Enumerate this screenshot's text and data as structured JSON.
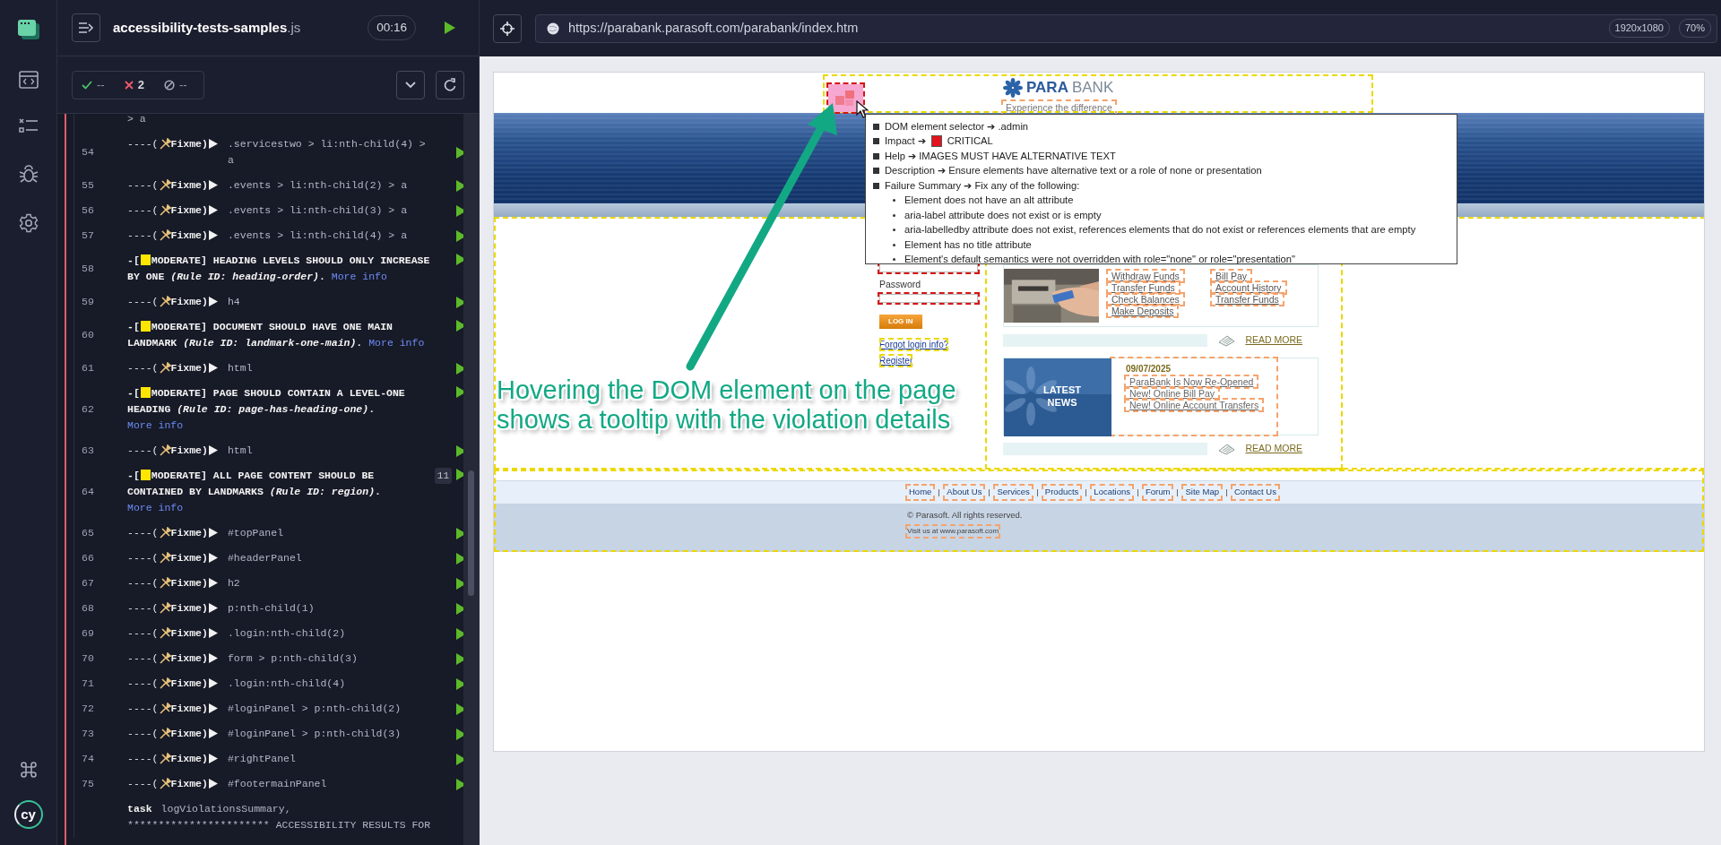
{
  "sidebar": {
    "logo_text": "cy"
  },
  "spec": {
    "name": "accessibility-tests-samples",
    "extension": ".js",
    "duration": "00:16"
  },
  "stats": {
    "passed": "--",
    "failed": "2",
    "pending": "--"
  },
  "log": [
    {
      "kind": "continuation",
      "selector": "> a"
    },
    {
      "kind": "fixme",
      "number": "54",
      "dashes": "----(",
      "tag": "Fixme)",
      "selector": ".servicestwo > li:nth-child(4) > a"
    },
    {
      "kind": "fixme",
      "number": "55",
      "dashes": "----(",
      "tag": "Fixme)",
      "selector": ".events > li:nth-child(2) > a"
    },
    {
      "kind": "fixme",
      "number": "56",
      "dashes": "----(",
      "tag": "Fixme)",
      "selector": ".events > li:nth-child(3) > a"
    },
    {
      "kind": "fixme",
      "number": "57",
      "dashes": "----(",
      "tag": "Fixme)",
      "selector": ".events > li:nth-child(4) > a"
    },
    {
      "kind": "violation",
      "number": "58",
      "dashes": "-[",
      "color": "#ffe600",
      "message": "MODERATE]  HEADING LEVELS SHOULD ONLY INCREASE BY ONE *(Rule ID: heading-order)*.",
      "link": "More info"
    },
    {
      "kind": "fixme",
      "number": "59",
      "dashes": "----(",
      "tag": "Fixme)",
      "selector": "h4"
    },
    {
      "kind": "violation",
      "number": "60",
      "dashes": "-[",
      "color": "#ffe600",
      "message": "MODERATE]  DOCUMENT SHOULD HAVE ONE MAIN LANDMARK *(Rule ID: landmark-one-main)*.",
      "link": "More info"
    },
    {
      "kind": "fixme",
      "number": "61",
      "dashes": "----(",
      "tag": "Fixme)",
      "selector": "html"
    },
    {
      "kind": "violation",
      "number": "62",
      "dashes": "-[",
      "color": "#ffe600",
      "message": "MODERATE]  PAGE SHOULD CONTAIN A LEVEL-ONE HEADING *(Rule ID: page-has-heading-one)*.",
      "link": "More info"
    },
    {
      "kind": "fixme",
      "number": "63",
      "dashes": "----(",
      "tag": "Fixme)",
      "selector": "html"
    },
    {
      "kind": "violation",
      "number": "64",
      "dashes": "-[",
      "color": "#ffe600",
      "message": "MODERATE]  ALL PAGE CONTENT SHOULD BE CONTAINED BY LANDMARKS *(Rule ID: region)*.",
      "link": "More info",
      "badge": "11"
    },
    {
      "kind": "fixme",
      "number": "65",
      "dashes": "----(",
      "tag": "Fixme)",
      "selector": "#topPanel"
    },
    {
      "kind": "fixme",
      "number": "66",
      "dashes": "----(",
      "tag": "Fixme)",
      "selector": "#headerPanel"
    },
    {
      "kind": "fixme",
      "number": "67",
      "dashes": "----(",
      "tag": "Fixme)",
      "selector": "h2"
    },
    {
      "kind": "fixme",
      "number": "68",
      "dashes": "----(",
      "tag": "Fixme)",
      "selector": "p:nth-child(1)"
    },
    {
      "kind": "fixme",
      "number": "69",
      "dashes": "----(",
      "tag": "Fixme)",
      "selector": ".login:nth-child(2)"
    },
    {
      "kind": "fixme",
      "number": "70",
      "dashes": "----(",
      "tag": "Fixme)",
      "selector": "form > p:nth-child(3)"
    },
    {
      "kind": "fixme",
      "number": "71",
      "dashes": "----(",
      "tag": "Fixme)",
      "selector": ".login:nth-child(4)"
    },
    {
      "kind": "fixme",
      "number": "72",
      "dashes": "----(",
      "tag": "Fixme)",
      "selector": "#loginPanel > p:nth-child(2)"
    },
    {
      "kind": "fixme",
      "number": "73",
      "dashes": "----(",
      "tag": "Fixme)",
      "selector": "#loginPanel > p:nth-child(3)"
    },
    {
      "kind": "fixme",
      "number": "74",
      "dashes": "----(",
      "tag": "Fixme)",
      "selector": "#rightPanel"
    },
    {
      "kind": "fixme",
      "number": "75",
      "dashes": "----(",
      "tag": "Fixme)",
      "selector": "#footermainPanel"
    },
    {
      "kind": "task",
      "name": "task",
      "selector": "logViolationsSummary,",
      "output": "*********************** ACCESSIBILITY RESULTS FOR"
    }
  ],
  "browser": {
    "url": "https://parabank.parasoft.com/parabank/index.htm",
    "viewport": "1920x1080",
    "zoom": "70%"
  },
  "app": {
    "header": {
      "brand_first": "PARA",
      "brand_second": "BANK",
      "tagline": "Experience the difference"
    },
    "login": {
      "password_label": "Password",
      "button": "LOG IN",
      "links": [
        "Forgot login info?",
        "Register"
      ]
    },
    "services": {
      "columns": [
        [
          "Withdraw Funds",
          "Transfer Funds",
          "Check Balances",
          "Make Deposits"
        ],
        [
          "Bill Pay",
          "Account History",
          "Transfer Funds"
        ]
      ],
      "read_more": "READ MORE"
    },
    "news": {
      "image_title": "LATEST NEWS",
      "date": "09/07/2025",
      "items": [
        "ParaBank Is Now Re-Opened",
        "New! Online Bill Pay",
        "New! Online Account Transfers"
      ],
      "read_more": "READ MORE"
    },
    "footer": {
      "links": [
        "Home",
        "About Us",
        "Services",
        "Products",
        "Locations",
        "Forum",
        "Site Map",
        "Contact Us"
      ],
      "copyright": "© Parasoft. All rights reserved.",
      "visit": "Visit us at www.parasoft.com"
    }
  },
  "tooltip": {
    "items": [
      {
        "kind": "text",
        "text": "DOM element selector ➔ .admin"
      },
      {
        "kind": "impact",
        "label": "Impact ➔",
        "value": "CRITICAL",
        "color": "#e3141d"
      },
      {
        "kind": "text",
        "text": "Help ➔ IMAGES MUST HAVE ALTERNATIVE TEXT"
      },
      {
        "kind": "text",
        "text": "Description ➔ Ensure  elements have alternative text or a role of none or presentation"
      },
      {
        "kind": "text",
        "text": "Failure Summary ➔ Fix any of the following:"
      }
    ],
    "failures": [
      "Element does not have an alt attribute",
      "aria-label attribute does not exist or is empty",
      "aria-labelledby attribute does not exist, references elements that do not exist or references elements that are empty",
      "Element has no title attribute",
      "Element's default semantics were not overridden with role=\"none\" or role=\"presentation\""
    ]
  },
  "annotation": {
    "lines": [
      "Hovering the DOM element on the page",
      "shows a tooltip with the violation details"
    ]
  }
}
